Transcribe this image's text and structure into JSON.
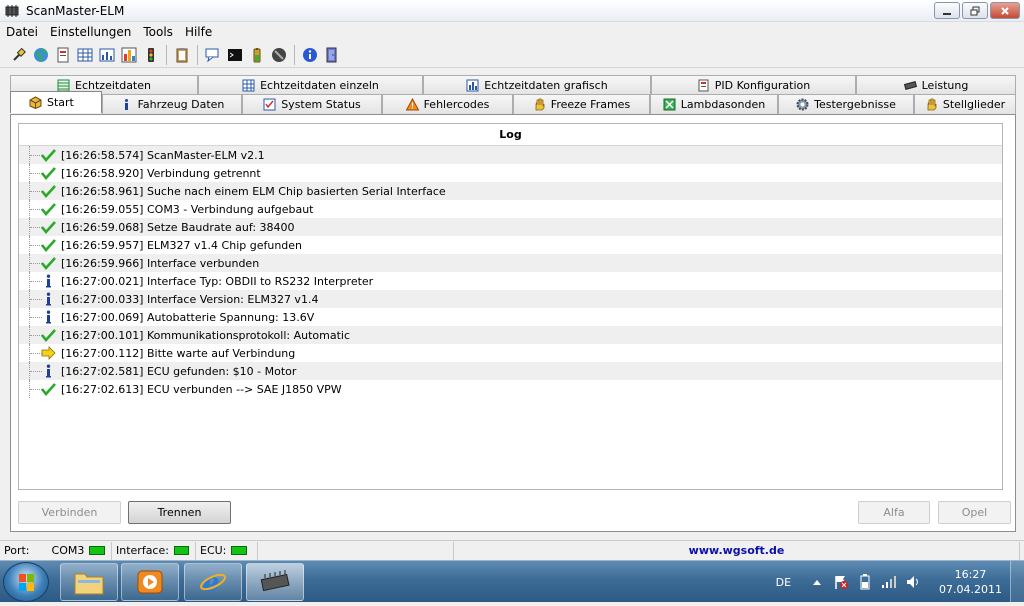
{
  "window": {
    "title": "ScanMaster-ELM"
  },
  "menu": [
    "Datei",
    "Einstellungen",
    "Tools",
    "Hilfe"
  ],
  "tabs": {
    "row1": [
      {
        "label": "Echtzeitdaten",
        "icon": "table-icon"
      },
      {
        "label": "Echtzeitdaten einzeln",
        "icon": "grid-icon"
      },
      {
        "label": "Echtzeitdaten grafisch",
        "icon": "chart-icon"
      },
      {
        "label": "PID Konfiguration",
        "icon": "document-icon"
      },
      {
        "label": "Leistung",
        "icon": "chip-icon"
      }
    ],
    "row2": [
      {
        "label": "Start",
        "icon": "box-icon",
        "active": true
      },
      {
        "label": "Fahrzeug Daten",
        "icon": "info-icon"
      },
      {
        "label": "System Status",
        "icon": "checklist-icon"
      },
      {
        "label": "Fehlercodes",
        "icon": "warning-icon"
      },
      {
        "label": "Freeze Frames",
        "icon": "hand-icon"
      },
      {
        "label": "Lambdasonden",
        "icon": "sensor-icon"
      },
      {
        "label": "Testergebnisse",
        "icon": "gear-icon"
      },
      {
        "label": "Stellglieder",
        "icon": "hand-icon"
      }
    ]
  },
  "log": {
    "header": "Log",
    "entries": [
      {
        "icon": "check",
        "text": "[16:26:58.574] ScanMaster-ELM v2.1"
      },
      {
        "icon": "check",
        "text": "[16:26:58.920] Verbindung getrennt"
      },
      {
        "icon": "check",
        "text": "[16:26:58.961] Suche nach einem ELM Chip basierten Serial Interface"
      },
      {
        "icon": "check",
        "text": "[16:26:59.055] COM3 - Verbindung aufgebaut"
      },
      {
        "icon": "check",
        "text": "[16:26:59.068] Setze Baudrate auf: 38400"
      },
      {
        "icon": "check",
        "text": "[16:26:59.957] ELM327 v1.4 Chip gefunden"
      },
      {
        "icon": "check",
        "text": "[16:26:59.966] Interface verbunden"
      },
      {
        "icon": "info",
        "text": "[16:27:00.021] Interface Typ: OBDII to RS232 Interpreter"
      },
      {
        "icon": "info",
        "text": "[16:27:00.033] Interface Version: ELM327 v1.4"
      },
      {
        "icon": "info",
        "text": "[16:27:00.069] Autobatterie Spannung: 13.6V"
      },
      {
        "icon": "check",
        "text": "[16:27:00.101] Kommunikationsprotokoll: Automatic"
      },
      {
        "icon": "arrow",
        "text": "[16:27:00.112] Bitte warte auf Verbindung"
      },
      {
        "icon": "info",
        "text": "[16:27:02.581] ECU gefunden: $10 - Motor"
      },
      {
        "icon": "check",
        "text": "[16:27:02.613] ECU verbunden --> SAE J1850 VPW"
      }
    ]
  },
  "buttons": {
    "connect": "Verbinden",
    "disconnect": "Trennen",
    "alfa": "Alfa",
    "opel": "Opel"
  },
  "status": {
    "port_label": "Port:",
    "port_value": "COM3",
    "interface_label": "Interface:",
    "ecu_label": "ECU:",
    "website": "www.wgsoft.de",
    "led_color": "#14c414"
  },
  "taskbar": {
    "lang": "DE",
    "time": "16:27",
    "date": "07.04.2011"
  },
  "colors": {
    "check": "#2aa92a",
    "info": "#1e3f9a",
    "arrow": "#f2d21a",
    "link": "#0a10a8"
  }
}
